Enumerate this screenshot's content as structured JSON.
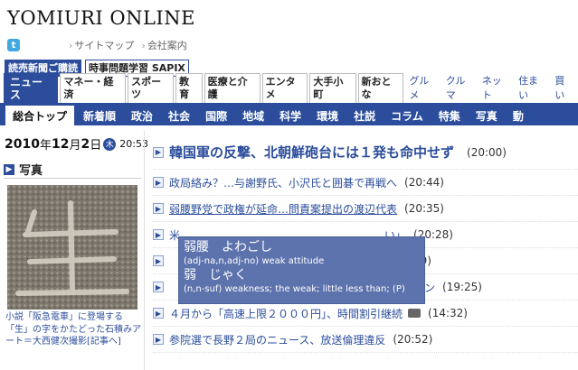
{
  "site": {
    "logo": "YOMIURI ONLINE"
  },
  "util_links": [
    "サイトマップ",
    "会社案内"
  ],
  "promo_buttons": [
    "読売新聞ご購読",
    "時事問題学習 SAPIX"
  ],
  "top_nav": {
    "tabs": [
      "ニュース",
      "マネー・経済",
      "スポーツ",
      "教育",
      "医療と介護",
      "エンタメ",
      "大手小町",
      "新おとな"
    ],
    "links": [
      "グルメ",
      "クルマ",
      "ネット",
      "住まい",
      "買い"
    ]
  },
  "sub_nav": [
    "総合トップ",
    "新着順",
    "政治",
    "社会",
    "国際",
    "地域",
    "科学",
    "環境",
    "社説",
    "コラム",
    "特集",
    "写真",
    "動"
  ],
  "date": {
    "year": "2010",
    "y_unit": "年",
    "month": "12",
    "m_unit": "月",
    "day": "2",
    "d_unit": "日",
    "weekday": "木",
    "time": "20:53"
  },
  "photo_section": {
    "title": "写真",
    "caption": "小説「阪急電車」に登場する「生」の字をかたどった石積みアート＝大西健次撮影[記事へ]"
  },
  "news": [
    {
      "title": "韓国軍の反撃、北朝鮮砲台には１発も命中せず",
      "time": "(20:00)"
    },
    {
      "title": "政局絡み？…与謝野氏、小沢氏と囲碁で再戦へ",
      "time": "(20:44)"
    },
    {
      "title": "弱腰野党で政権が延命…問責案提出の渡辺代表",
      "time": "(20:35)"
    },
    {
      "title": "米",
      "time": "(20:28)",
      "tail": "い」"
    },
    {
      "title": "",
      "time": "(20:09)"
    },
    {
      "title": "",
      "time": "(19:25)",
      "tail": "ゾン"
    },
    {
      "title": "４月から「高速上限２０００円」、時間割引継続",
      "time": "(14:32)"
    },
    {
      "title": "参院選で長野２局のニュース、放送倫理違反",
      "time": "(20:52)"
    }
  ],
  "popup": {
    "w1": "弱腰",
    "r1": "よわごし",
    "d1": "(adj-na,n,adj-no) weak attitude",
    "w2": "弱",
    "r2": "じゃく",
    "d2": "(n,n-suf) weakness; the weak; little less than; (P)"
  },
  "colors": {
    "brand_blue": "#2b4d9b",
    "popup_bg": "#5d73ad"
  }
}
